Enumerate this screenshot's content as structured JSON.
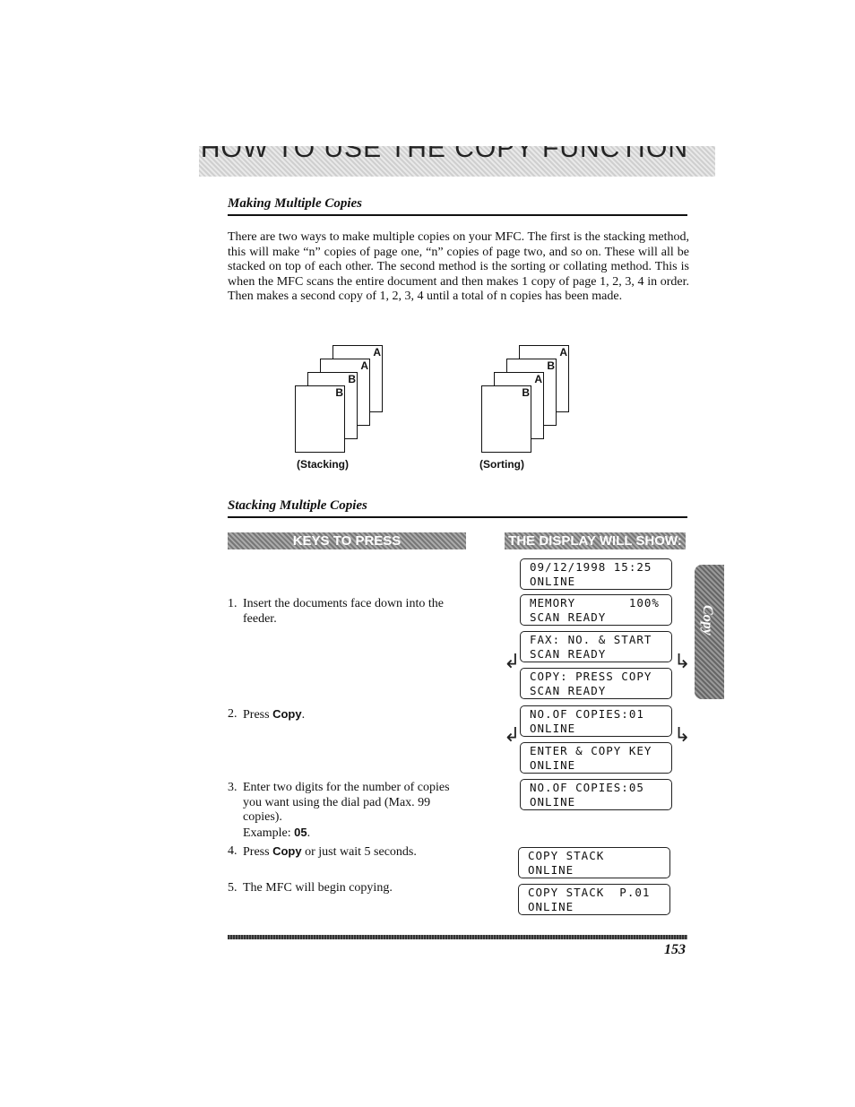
{
  "header": {
    "running_title": "HOW TO USE THE COPY FUNCTION"
  },
  "section1": {
    "heading": "Making Multiple Copies",
    "paragraph": "There are two ways to make multiple copies on your MFC. The first is the stacking method, this will make “n” copies of page one, “n” copies of page two, and so on. These will all be stacked on top of each other. The second method is the sorting or collating method. This is when the MFC scans the entire document and then makes 1 copy of page 1, 2, 3, 4 in order. Then makes a second copy of 1, 2, 3, 4 until a total of n copies has been made."
  },
  "diagrams": {
    "stacking": {
      "caption": "(Stacking)",
      "pages": [
        "A",
        "A",
        "B",
        "B"
      ]
    },
    "sorting": {
      "caption": "(Sorting)",
      "pages": [
        "A",
        "B",
        "A",
        "B"
      ]
    }
  },
  "section2": {
    "heading": "Stacking Multiple Copies",
    "keys_banner": "KEYS TO PRESS",
    "display_banner": "THE DISPLAY WILL SHOW:"
  },
  "steps": [
    {
      "num": "1.",
      "text": "Insert the documents face down into the feeder."
    },
    {
      "num": "2.",
      "pre": "Press ",
      "key": "Copy",
      "post": "."
    },
    {
      "num": "3.",
      "text": "Enter two digits for the number of copies you want using the dial pad (Max. 99 copies).",
      "example_label": "Example: ",
      "example": "05",
      "post": "."
    },
    {
      "num": "4.",
      "pre": "Press ",
      "key": "Copy",
      "post": " or just wait 5 seconds."
    },
    {
      "num": "5.",
      "text": "The MFC will begin copying."
    }
  ],
  "displays": [
    {
      "l1": "09/12/1998 15:25",
      "l2": "ONLINE"
    },
    {
      "l1": "MEMORY       100%",
      "l2": "SCAN READY"
    },
    {
      "l1": "FAX: NO. & START",
      "l2": "SCAN READY"
    },
    {
      "l1": "COPY: PRESS COPY",
      "l2": "SCAN READY"
    },
    {
      "l1": "NO.OF COPIES:01",
      "l2": "ONLINE"
    },
    {
      "l1": "ENTER & COPY KEY",
      "l2": "ONLINE"
    },
    {
      "l1": "NO.OF COPIES:05",
      "l2": "ONLINE"
    },
    {
      "l1": "COPY STACK",
      "l2": "ONLINE"
    },
    {
      "l1": "COPY STACK  P.01",
      "l2": "ONLINE"
    }
  ],
  "side_tab": "Copy",
  "page_number": "153"
}
